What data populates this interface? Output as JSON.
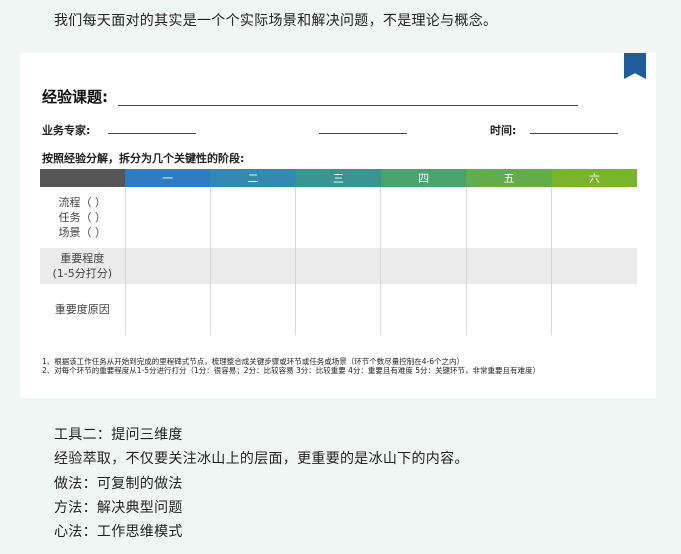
{
  "intro": "我们每天面对的其实是一个个实际场景和解决问题，不是理论与概念。",
  "form": {
    "title": "经验课题:",
    "expert_label": "业务专家:",
    "time_label": "时间:",
    "subheading": "按照经验分解，拆分为几个关键性的阶段:",
    "stage_headers": [
      "一",
      "二",
      "三",
      "四",
      "五",
      "六"
    ],
    "stage_colors": [
      "#2f7bbf",
      "#3588b0",
      "#3a9490",
      "#4ba26d",
      "#62ad4b",
      "#78b42c"
    ],
    "corner_color": "#555555",
    "rows": [
      {
        "label_lines": [
          "流程（ ）",
          "任务（ ）",
          "场景（ ）"
        ]
      },
      {
        "label_lines": [
          "重要程度",
          "(1-5分打分)"
        ]
      },
      {
        "label_lines": [
          "重要度原因"
        ]
      }
    ],
    "notes": [
      "1、根据该工作任务从开始到完成的里程碑式节点，梳理整合成关键步骤或环节或任务或场景（环节个数尽量控制在4-6个之内）",
      "2、对每个环节的重要程度从1-5分进行打分（1分：很容易；2分：比较容易   3分：比较重要   4分：重要且有难度    5分：关键环节，非常重要且有难度）"
    ]
  },
  "paragraphs": [
    "工具二：提问三维度",
    "经验萃取，不仅要关注冰山上的层面，更重要的是冰山下的内容。",
    "做法：可复制的做法",
    "方法：解决典型问题",
    "心法：工作思维模式"
  ]
}
